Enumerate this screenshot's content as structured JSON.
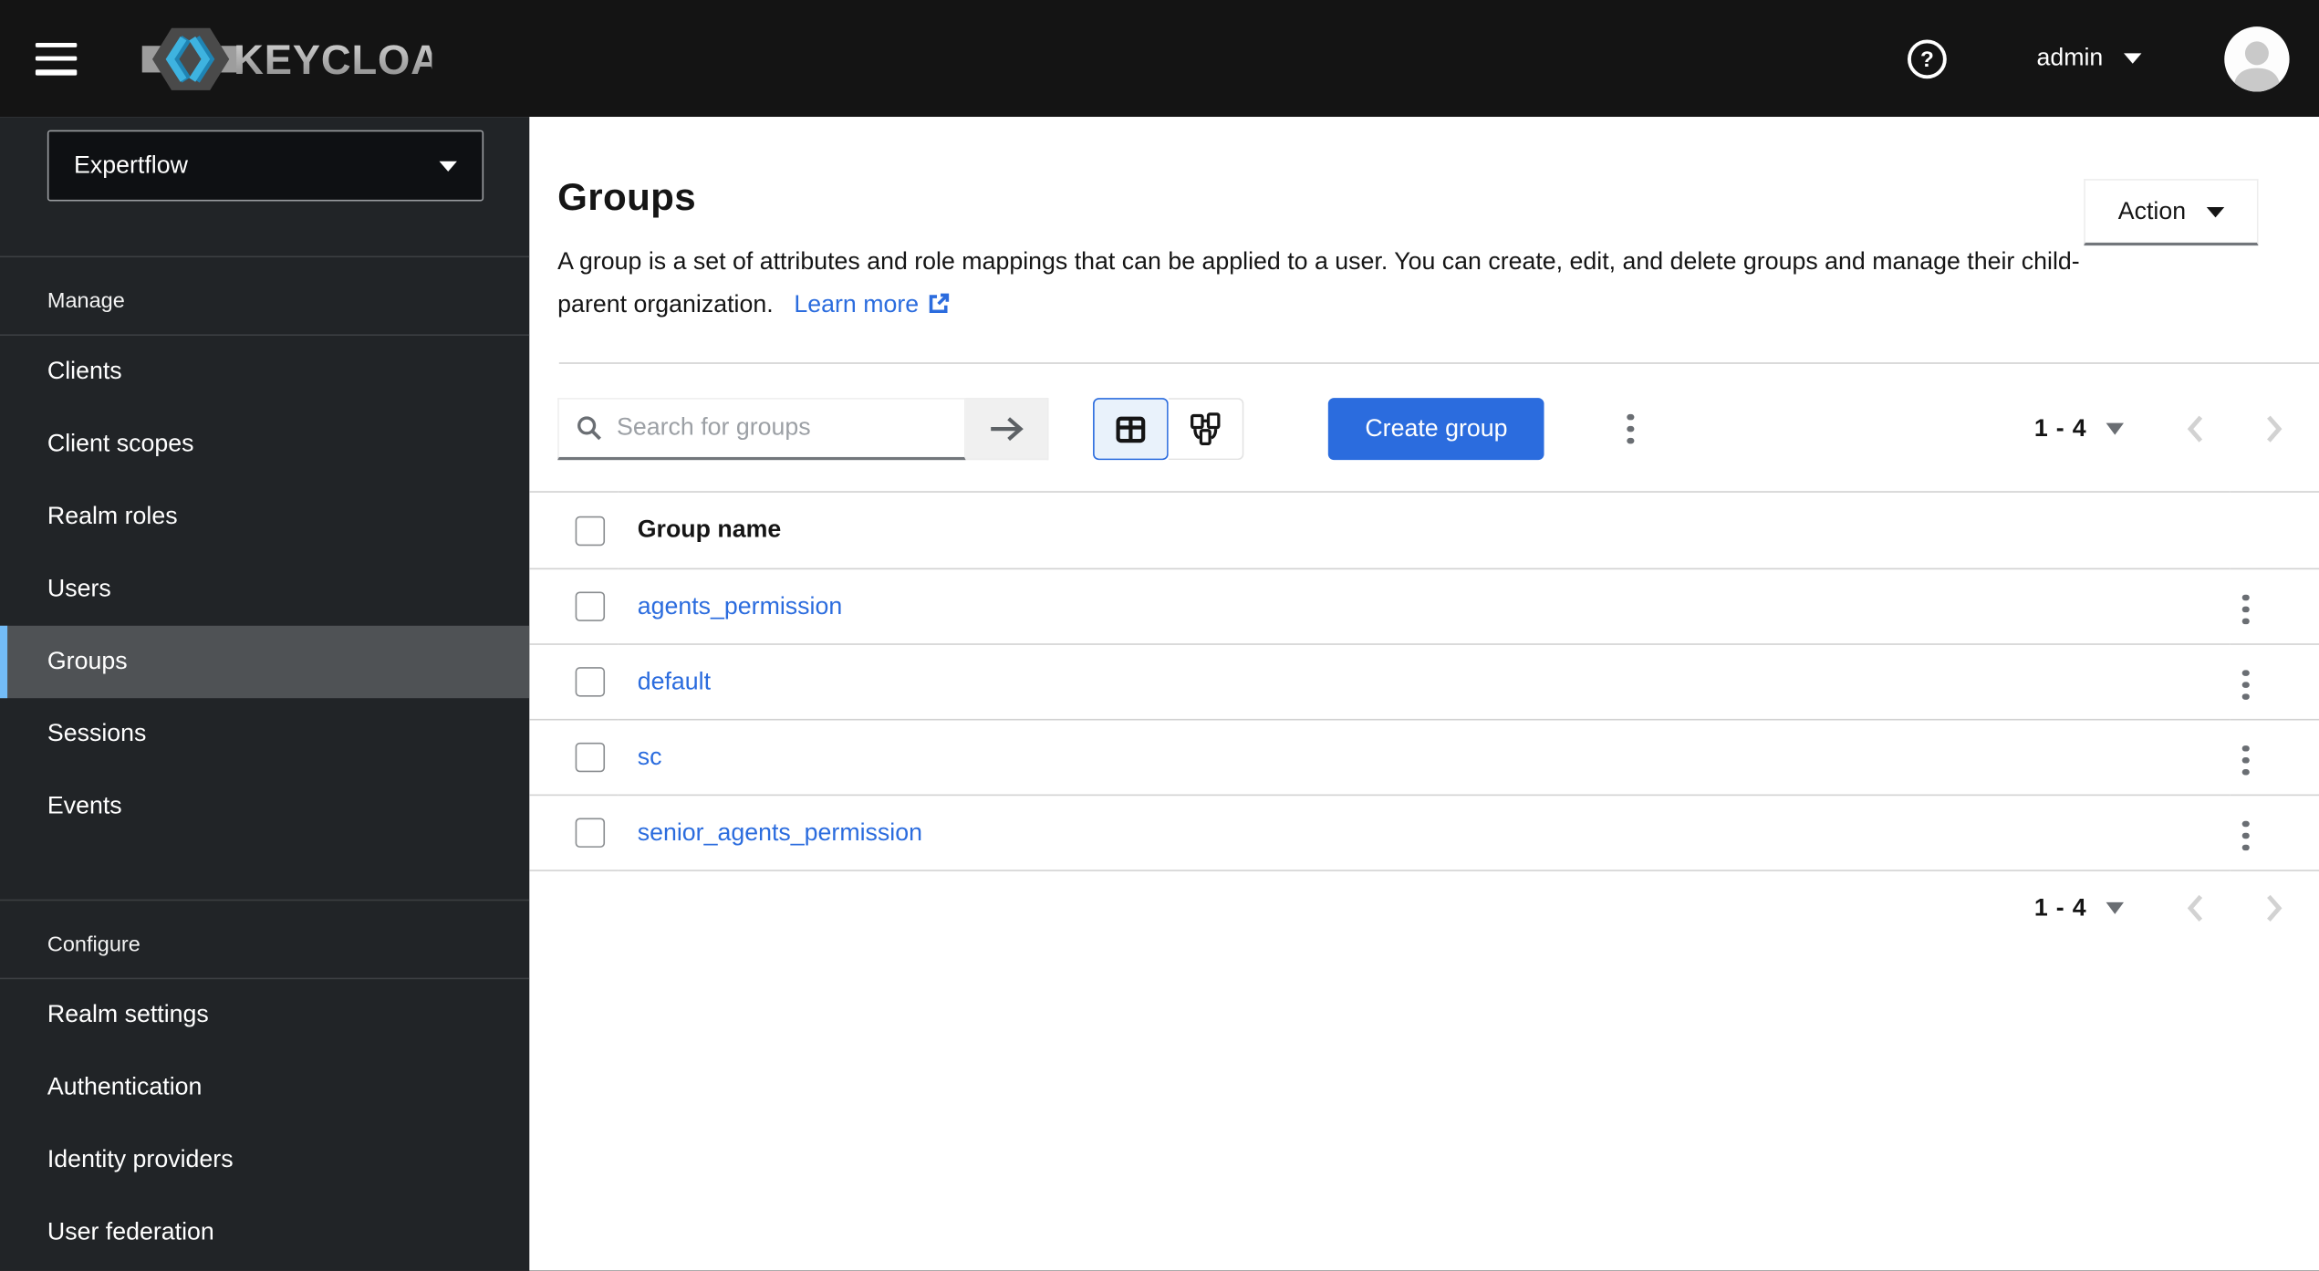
{
  "masthead": {
    "brand_text": "KEYCLOAK",
    "help_glyph": "?",
    "username": "admin"
  },
  "sidebar": {
    "realm_name": "Expertflow",
    "sections": [
      {
        "label": "Manage",
        "items": [
          {
            "label": "Clients",
            "active": false
          },
          {
            "label": "Client scopes",
            "active": false
          },
          {
            "label": "Realm roles",
            "active": false
          },
          {
            "label": "Users",
            "active": false
          },
          {
            "label": "Groups",
            "active": true
          },
          {
            "label": "Sessions",
            "active": false
          },
          {
            "label": "Events",
            "active": false
          }
        ]
      },
      {
        "label": "Configure",
        "items": [
          {
            "label": "Realm settings"
          },
          {
            "label": "Authentication"
          },
          {
            "label": "Identity providers"
          },
          {
            "label": "User federation"
          }
        ]
      }
    ]
  },
  "page": {
    "title": "Groups",
    "description": "A group is a set of attributes and role mappings that can be applied to a user. You can create, edit, and delete groups and manage their child-parent organization.",
    "learn_more_label": "Learn more",
    "action_button_label": "Action"
  },
  "toolbar": {
    "search_placeholder": "Search for groups",
    "search_submit_glyph": "→",
    "create_button_label": "Create group",
    "pagination_range": "1 - 4"
  },
  "table": {
    "name_header": "Group name",
    "rows": [
      {
        "name": "agents_permission"
      },
      {
        "name": "default"
      },
      {
        "name": "sc"
      },
      {
        "name": "senior_agents_permission"
      }
    ]
  },
  "bottom_pagination": {
    "range": "1 - 4"
  },
  "icons": {
    "nav_toggle": "hamburger-3-bars",
    "help": "question-circle",
    "user_caret": "triangle-down",
    "avatar": "person-silhouette",
    "search": "magnifier",
    "view_table": "table-grid",
    "view_tree": "tree-hierarchy",
    "row_actions": "kebab-vertical-dots",
    "external_link": "box-arrow-up-right",
    "prev_page": "chevron-left",
    "next_page": "chevron-right"
  },
  "colors": {
    "masthead_bg": "#141414",
    "sidebar_bg": "#212427",
    "sidebar_divider": "#3c3f42",
    "sidebar_active_bg": "#4f5255",
    "sidebar_active_border": "#73bcf7",
    "primary_blue": "#2b6cde",
    "link_blue": "#2b6cde",
    "toggle_selected_bg": "#e9f2fb",
    "border_gray": "#d2d2d2",
    "icon_gray": "#6a6e73",
    "text_dark": "#151515"
  }
}
